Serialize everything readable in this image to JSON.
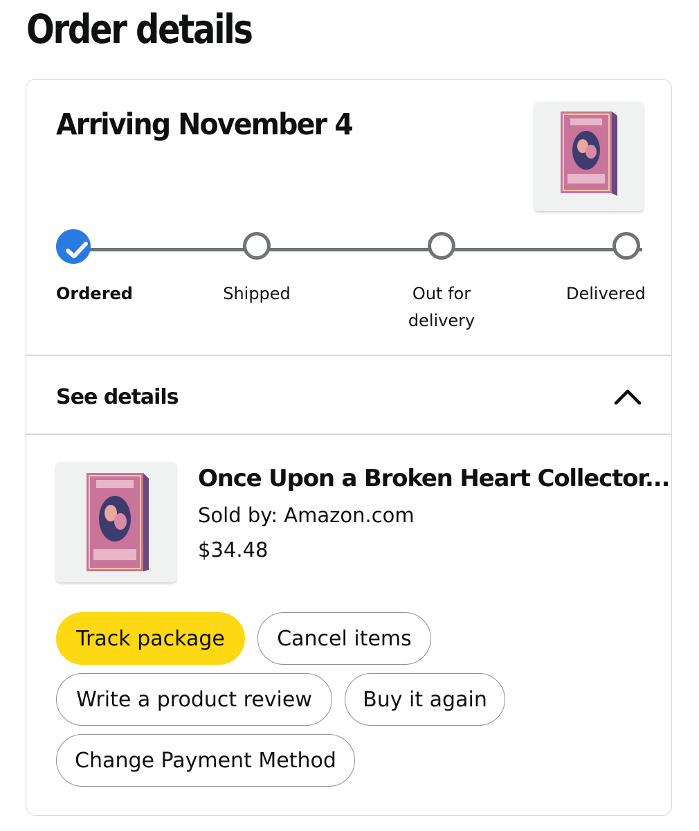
{
  "page": {
    "title": "Order details"
  },
  "shipment": {
    "arrival": "Arriving November 4",
    "steps": [
      {
        "label": "Ordered",
        "done": true
      },
      {
        "label": "Shipped",
        "done": false
      },
      {
        "label": "Out for\ndelivery",
        "done": false
      },
      {
        "label": "Delivered",
        "done": false
      }
    ],
    "progress_fraction": 0.0
  },
  "details_toggle": {
    "label": "See details",
    "state": "expanded"
  },
  "item": {
    "title": "Once Upon a Broken Heart Collector...",
    "seller": "Sold by: Amazon.com",
    "price": "$34.48",
    "image_icon": "book-cover-image"
  },
  "actions": {
    "track": "Track package",
    "cancel": "Cancel items",
    "review": "Write a product review",
    "buy_again": "Buy it again",
    "change_payment": "Change Payment Method"
  },
  "colors": {
    "primary_button": "#FFD814",
    "step_done": "#2A7AE2",
    "track_line": "#6F7373",
    "card_border": "#D5D9D9"
  }
}
